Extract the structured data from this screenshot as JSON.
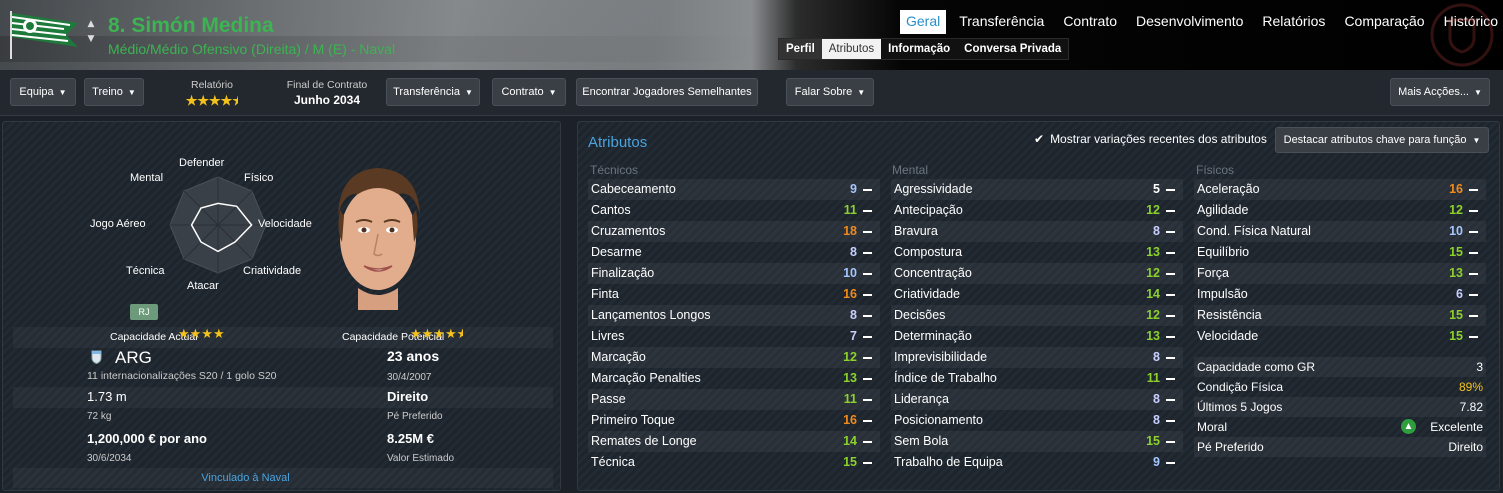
{
  "header": {
    "player_name": "8. Simón Medina",
    "positions": "Médio/Médio Ofensivo (Direita) / M (E) - Naval",
    "tabs": [
      "Geral",
      "Transferência",
      "Contrato",
      "Desenvolvimento",
      "Relatórios",
      "Comparação",
      "Histórico"
    ],
    "active_tab": "Geral",
    "subtabs": [
      "Perfil",
      "Atributos",
      "Informação",
      "Conversa Privada"
    ],
    "active_subtab": "Atributos"
  },
  "toolbar": {
    "equipa": "Equipa",
    "treino": "Treino",
    "relatorio_label": "Relatório",
    "relatorio_stars": 4.5,
    "contract_end_label": "Final de Contrato",
    "contract_end_value": "Junho 2034",
    "transferencia": "Transferência",
    "contrato": "Contrato",
    "encontrar": "Encontrar Jogadores Semelhantes",
    "falar": "Falar Sobre",
    "mais": "Mais Acções..."
  },
  "profile": {
    "radar_labels": {
      "top": "Defender",
      "top_right": "Físico",
      "right": "Velocidade",
      "bottom_right": "Criatividade",
      "bottom": "Atacar",
      "bottom_left": "Técnica",
      "left": "Jogo Aéreo",
      "top_left": "Mental"
    },
    "radar_values": [
      0.45,
      0.55,
      0.7,
      0.5,
      0.55,
      0.5,
      0.55,
      0.5
    ],
    "role_badge": "RJ",
    "cap_actual_label": "Capacidade Actual",
    "cap_actual_stars": 4,
    "cap_potential_label": "Capacidade Potencial",
    "cap_potential_stars": 4.5,
    "nationality": "ARG",
    "caps": "11 internacionalizações S20 / 1 golo S20",
    "age": "23 anos",
    "dob": "30/4/2007",
    "height": "1.73 m",
    "weight": "72 kg",
    "foot": "Direito",
    "foot_label": "Pé Preferido",
    "wage": "1,200,000 € por ano",
    "wage_expiry": "30/6/2034",
    "value": "8.25M €",
    "value_label": "Valor Estimado",
    "club_link": "Vinculado à Naval"
  },
  "attributes": {
    "title": "Atributos",
    "show_changes_label": "Mostrar variações recentes dos atributos",
    "highlight_button": "Destacar atributos chave para função",
    "tecnicos_header": "Técnicos",
    "mental_header": "Mental",
    "fisicos_header": "Físicos",
    "tecnicos": [
      {
        "name": "Cabeceamento",
        "value": 9
      },
      {
        "name": "Cantos",
        "value": 11
      },
      {
        "name": "Cruzamentos",
        "value": 18
      },
      {
        "name": "Desarme",
        "value": 8
      },
      {
        "name": "Finalização",
        "value": 10
      },
      {
        "name": "Finta",
        "value": 16
      },
      {
        "name": "Lançamentos Longos",
        "value": 8
      },
      {
        "name": "Livres",
        "value": 7
      },
      {
        "name": "Marcação",
        "value": 12
      },
      {
        "name": "Marcação Penalties",
        "value": 13
      },
      {
        "name": "Passe",
        "value": 11
      },
      {
        "name": "Primeiro Toque",
        "value": 16
      },
      {
        "name": "Remates de Longe",
        "value": 14
      },
      {
        "name": "Técnica",
        "value": 15
      }
    ],
    "mental": [
      {
        "name": "Agressividade",
        "value": 5
      },
      {
        "name": "Antecipação",
        "value": 12
      },
      {
        "name": "Bravura",
        "value": 8
      },
      {
        "name": "Compostura",
        "value": 13
      },
      {
        "name": "Concentração",
        "value": 12
      },
      {
        "name": "Criatividade",
        "value": 14
      },
      {
        "name": "Decisões",
        "value": 12
      },
      {
        "name": "Determinação",
        "value": 13
      },
      {
        "name": "Imprevisibilidade",
        "value": 8
      },
      {
        "name": "Índice de Trabalho",
        "value": 11
      },
      {
        "name": "Liderança",
        "value": 8
      },
      {
        "name": "Posicionamento",
        "value": 8
      },
      {
        "name": "Sem Bola",
        "value": 15
      },
      {
        "name": "Trabalho de Equipa",
        "value": 9
      }
    ],
    "fisicos": [
      {
        "name": "Aceleração",
        "value": 16
      },
      {
        "name": "Agilidade",
        "value": 12
      },
      {
        "name": "Cond. Física Natural",
        "value": 10
      },
      {
        "name": "Equilíbrio",
        "value": 15
      },
      {
        "name": "Força",
        "value": 13
      },
      {
        "name": "Impulsão",
        "value": 6
      },
      {
        "name": "Resistência",
        "value": 15
      },
      {
        "name": "Velocidade",
        "value": 15
      }
    ],
    "stats": [
      {
        "name": "Capacidade como GR",
        "value": "3"
      },
      {
        "name": "Condição Física",
        "value": "89%"
      },
      {
        "name": "Últimos 5 Jogos",
        "value": "7.82"
      },
      {
        "name": "Moral",
        "value": "Excelente"
      },
      {
        "name": "Pé Preferido",
        "value": "Direito"
      }
    ]
  },
  "colors": {
    "accent": "#3bb451",
    "link": "#4aa3df",
    "high": "#f08b1f",
    "good": "#8cd12c",
    "mid": "#c8d0ff",
    "star": "#f4c21a"
  }
}
